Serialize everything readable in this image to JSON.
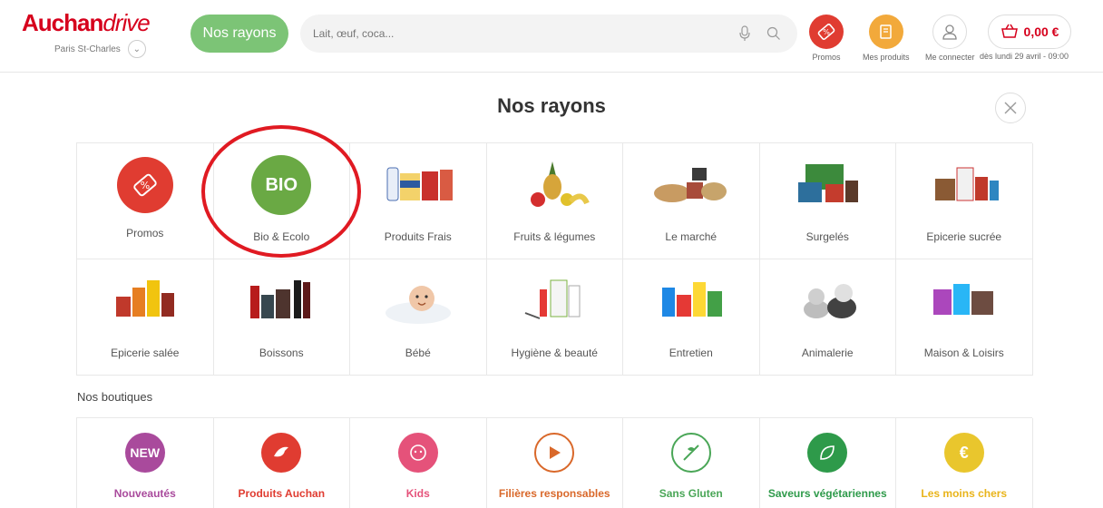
{
  "header": {
    "logo_brand": "Auchan",
    "logo_suffix": "drive",
    "store_name": "Paris St-Charles",
    "nav_button": "Nos rayons",
    "search_placeholder": "Lait, œuf, coca...",
    "promos_label": "Promos",
    "mes_produits_label": "Mes produits",
    "connect_label": "Me connecter",
    "cart_amount": "0,00 €",
    "cart_sub": "dès lundi 29 avril - 09:00"
  },
  "page": {
    "title": "Nos rayons",
    "boutiques_title": "Nos boutiques"
  },
  "rayons": [
    {
      "label": "Promos",
      "icon": "promo-tag-icon"
    },
    {
      "label": "Bio & Ecolo",
      "icon": "bio-icon",
      "badge": "BIO"
    },
    {
      "label": "Produits Frais",
      "icon": "fresh-products-image"
    },
    {
      "label": "Fruits & légumes",
      "icon": "fruits-image"
    },
    {
      "label": "Le marché",
      "icon": "market-image"
    },
    {
      "label": "Surgelés",
      "icon": "frozen-image"
    },
    {
      "label": "Epicerie sucrée",
      "icon": "sweet-grocery-image"
    },
    {
      "label": "Epicerie salée",
      "icon": "savory-grocery-image"
    },
    {
      "label": "Boissons",
      "icon": "drinks-image"
    },
    {
      "label": "Bébé",
      "icon": "baby-image"
    },
    {
      "label": "Hygiène & beauté",
      "icon": "hygiene-image"
    },
    {
      "label": "Entretien",
      "icon": "cleaning-image"
    },
    {
      "label": "Animalerie",
      "icon": "pets-image"
    },
    {
      "label": "Maison & Loisirs",
      "icon": "home-image"
    }
  ],
  "boutiques": [
    {
      "label": "Nouveautés",
      "color": "#a94a9c",
      "badge": "NEW"
    },
    {
      "label": "Produits Auchan",
      "color": "#e03c31",
      "badge": ""
    },
    {
      "label": "Kids",
      "color": "#e5527a",
      "badge": ""
    },
    {
      "label": "Filières responsables",
      "color": "#d9682a",
      "badge": ""
    },
    {
      "label": "Sans Gluten",
      "color": "#4aa657",
      "badge": ""
    },
    {
      "label": "Saveurs végétariennes",
      "color": "#2e9a4a",
      "badge": ""
    },
    {
      "label": "Les moins chers",
      "color": "#e9b41a",
      "badge": "€"
    }
  ],
  "colors": {
    "brand_red": "#d6001c",
    "nav_green": "#7cc476",
    "promo_red": "#e03c31",
    "orange": "#f2a93b"
  }
}
